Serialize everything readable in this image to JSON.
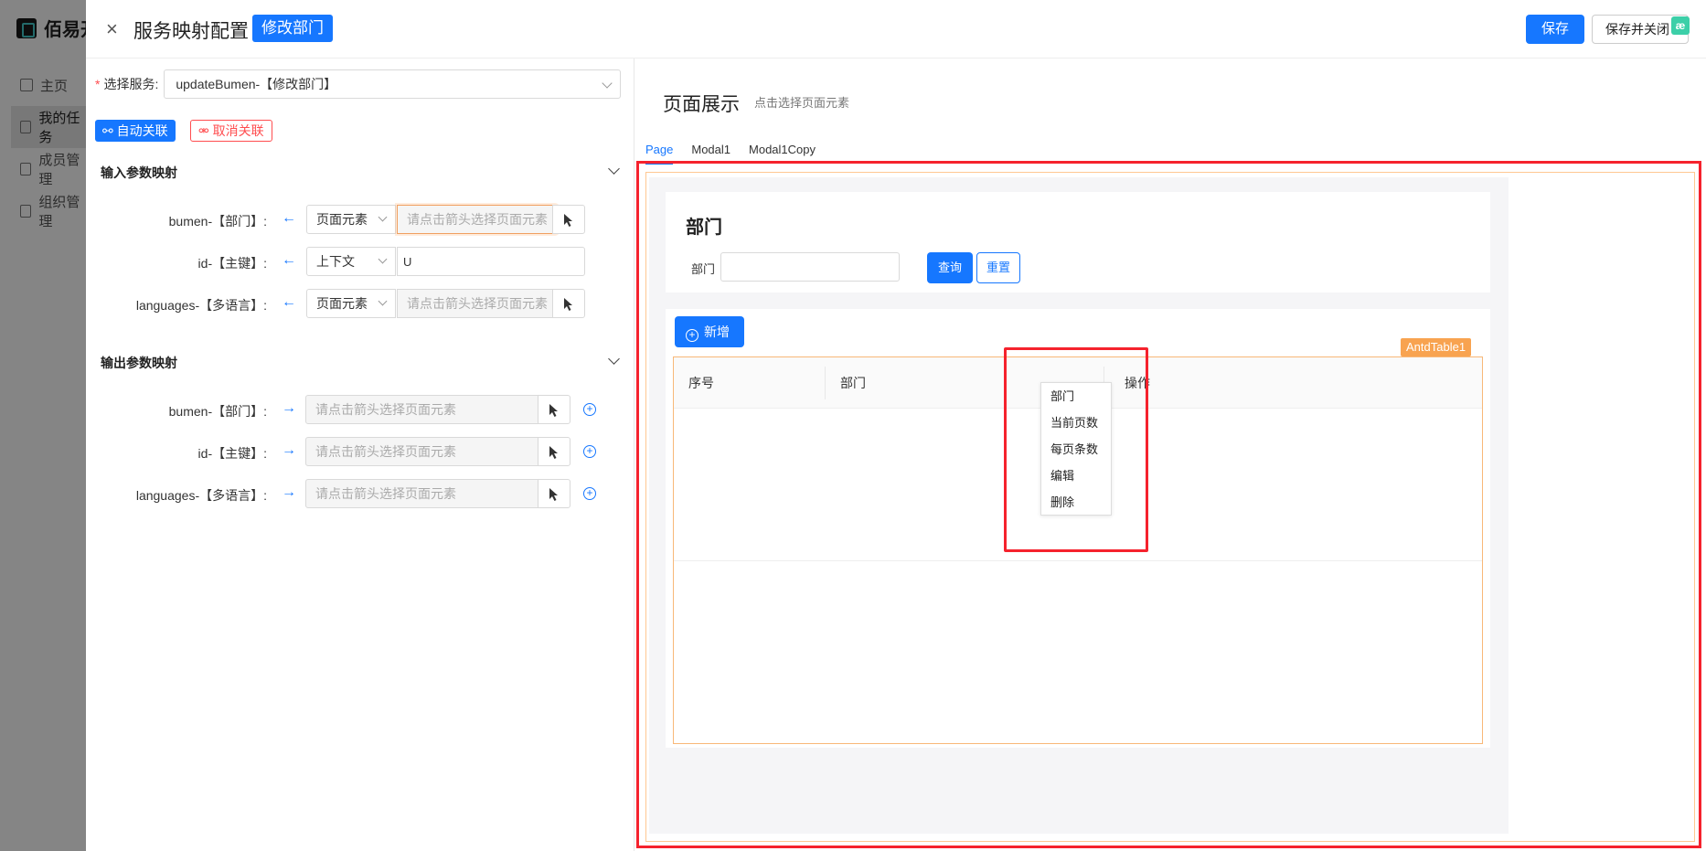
{
  "background_app": {
    "logo_text": "佰易开",
    "nav": [
      {
        "label": "主页",
        "icon": "home-icon",
        "active": false
      },
      {
        "label": "我的任务",
        "icon": "file-icon",
        "active": true
      },
      {
        "label": "成员管理",
        "icon": "user-icon",
        "active": false
      },
      {
        "label": "组织管理",
        "icon": "org-icon",
        "active": false
      }
    ]
  },
  "header": {
    "title": "服务映射配置",
    "tag": "修改部门",
    "save_label": "保存",
    "save_close_label": "保存并关闭"
  },
  "left": {
    "service_label": "选择服务:",
    "service_value": "updateBumen-【修改部门】",
    "auto_link_label": "自动关联",
    "cancel_link_label": "取消关联",
    "input_section_title": "输入参数映射",
    "output_section_title": "输出参数映射",
    "inputs": [
      {
        "label": "bumen-【部门】:",
        "source": "页面元素",
        "placeholder": "请点击箭头选择页面元素",
        "value": ""
      },
      {
        "label": "id-【主键】:",
        "source": "上下文",
        "placeholder": "",
        "value": "U"
      },
      {
        "label": "languages-【多语言】:",
        "source": "页面元素",
        "placeholder": "请点击箭头选择页面元素",
        "value": ""
      }
    ],
    "outputs": [
      {
        "label": "bumen-【部门】:",
        "placeholder": "请点击箭头选择页面元素"
      },
      {
        "label": "id-【主键】:",
        "placeholder": "请点击箭头选择页面元素"
      },
      {
        "label": "languages-【多语言】:",
        "placeholder": "请点击箭头选择页面元素"
      }
    ]
  },
  "right": {
    "title": "页面展示",
    "subtitle": "点击选择页面元素",
    "tabs": [
      "Page",
      "Modal1",
      "Modal1Copy"
    ],
    "active_tab": "Page",
    "page": {
      "card_title": "部门",
      "filter_label": "部门",
      "query_label": "查询",
      "reset_label": "重置",
      "add_label": "新增",
      "table_tag": "AntdTable1",
      "columns": [
        "序号",
        "部门",
        "操作"
      ]
    },
    "context_menu": [
      "部门",
      "当前页数",
      "每页条数",
      "编辑",
      "删除"
    ]
  },
  "colors": {
    "primary": "#1677ff",
    "danger": "#ff4d4f",
    "highlight_red": "#f5222d",
    "table_orange": "#f8a350"
  }
}
